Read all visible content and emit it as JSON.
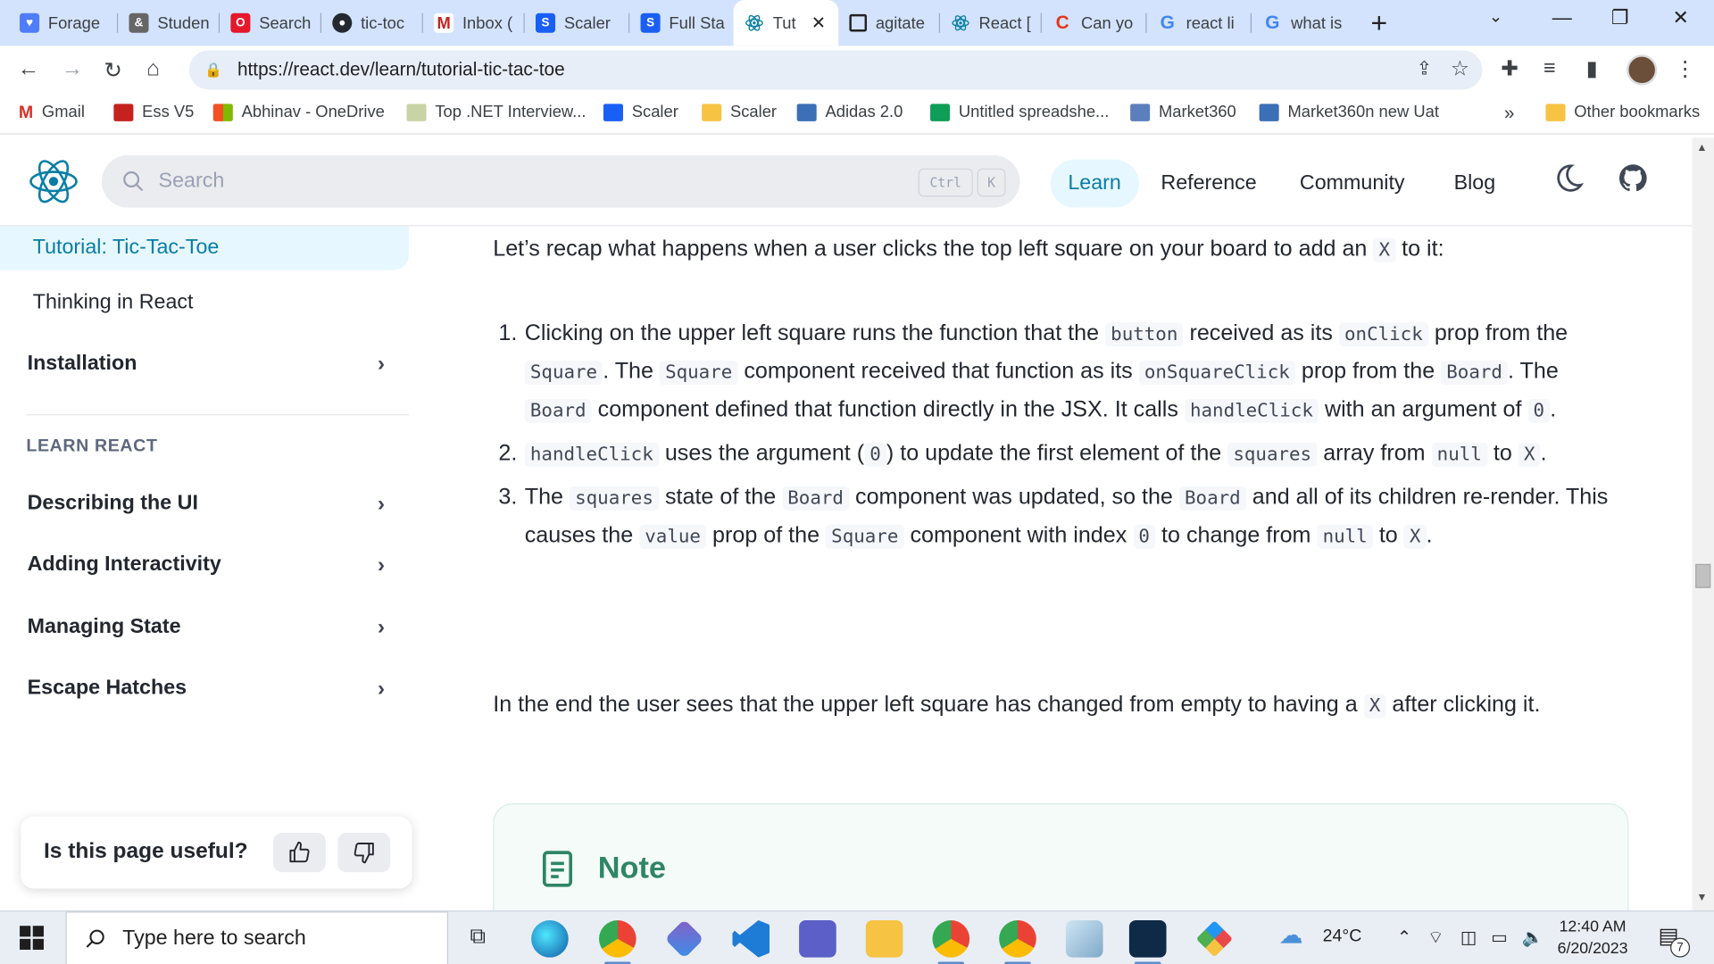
{
  "browser": {
    "tabs": [
      {
        "title": "Forage",
        "icon": "forage-icon",
        "color": "#4f7df9"
      },
      {
        "title": "Studen",
        "icon": "student-icon",
        "color": "#666666"
      },
      {
        "title": "Search",
        "icon": "opera-search-icon",
        "color": "#e5172a"
      },
      {
        "title": "tic-toc",
        "icon": "github-icon",
        "color": "#24292f"
      },
      {
        "title": "Inbox (",
        "icon": "gmail-icon",
        "color": "#c5221f"
      },
      {
        "title": "Scaler",
        "icon": "scaler-icon",
        "color": "#1a5ff5"
      },
      {
        "title": "Full Sta",
        "icon": "scaler-icon",
        "color": "#1a5ff5"
      },
      {
        "title": "Tut",
        "icon": "react-icon",
        "color": "#087ea4",
        "active": true
      },
      {
        "title": "agitate",
        "icon": "page-icon",
        "color": "#222222"
      },
      {
        "title": "React [",
        "icon": "react-icon",
        "color": "#087ea4"
      },
      {
        "title": "Can yo",
        "icon": "c-icon",
        "color": "#e03a1a"
      },
      {
        "title": "react li",
        "icon": "google-icon",
        "color": "#4285f4"
      },
      {
        "title": "what is",
        "icon": "google-icon",
        "color": "#4285f4"
      }
    ],
    "tab_close": "✕",
    "new_tab": "+",
    "url": "https://react.dev/learn/tutorial-tic-tac-toe",
    "bookmarks": [
      {
        "label": "Gmail",
        "color": "#d93025"
      },
      {
        "label": "Ess V5",
        "color": "#c5221f"
      },
      {
        "label": "Abhinav - OneDrive",
        "color": "#f25022"
      },
      {
        "label": "Top .NET Interview...",
        "color": "#8a9a5b"
      },
      {
        "label": "Scaler",
        "color": "#1a5ff5"
      },
      {
        "label": "Scaler",
        "color": "#f6c343"
      },
      {
        "label": "Adidas 2.0",
        "color": "#3b6fb6"
      },
      {
        "label": "Untitled spreadshe...",
        "color": "#0f9d58"
      },
      {
        "label": "Market360",
        "color": "#5b7fbd"
      },
      {
        "label": "Market360n new Uat",
        "color": "#3b6fb6"
      }
    ],
    "more_bookmarks": "»",
    "other_bookmarks": "Other bookmarks"
  },
  "site": {
    "search_placeholder": "Search",
    "kbd_ctrl": "Ctrl",
    "kbd_k": "K",
    "nav": [
      "Learn",
      "Reference",
      "Community",
      "Blog"
    ],
    "accent": "#087ea4"
  },
  "sidebar": {
    "active_item": "Tutorial: Tic-Tac-Toe",
    "thinking": "Thinking in React",
    "installation": "Installation",
    "section_title": "LEARN REACT",
    "items": [
      "Describing the UI",
      "Adding Interactivity",
      "Managing State",
      "Escape Hatches"
    ],
    "feedback_question": "Is this page useful?"
  },
  "content": {
    "intro_a": "Let’s recap what happens when a user clicks the top left square on your board to add an ",
    "intro_code": "X",
    "intro_b": " to it:",
    "steps": [
      {
        "num": "1.",
        "t1": "Clicking on the upper left square runs the function that the ",
        "c1": "button",
        "t2": " received as its ",
        "c2": "onClick",
        "t3": " prop from the ",
        "c3": "Square",
        "t4": ". The ",
        "c4": "Square",
        "t5": " component received that function as its ",
        "c5": "onSquareClick",
        "t6": " prop from the ",
        "c6": "Board",
        "t7": ". The ",
        "c7": "Board",
        "t8": " component defined that function directly in the JSX. It calls ",
        "c8": "handleClick",
        "t9": " with an argument of ",
        "c9": "0",
        "t10": "."
      },
      {
        "num": "2.",
        "c1": "handleClick",
        "t1": " uses the argument (",
        "c2": "0",
        "t2": ") to update the first element of the ",
        "c3": "squares",
        "t3": " array from ",
        "c4": "null",
        "t4": " to ",
        "c5": "X",
        "t5": "."
      },
      {
        "num": "3.",
        "t1": "The ",
        "c1": "squares",
        "t2": " state of the ",
        "c2": "Board",
        "t3": " component was updated, so the ",
        "c3": "Board",
        "t4": " and all of its children re-render. This causes the ",
        "c4": "value",
        "t5": " prop of the ",
        "c5": "Square",
        "t6": " component with index ",
        "c6": "0",
        "t7": " to change from ",
        "c7": "null",
        "t8": " to ",
        "c8": "X",
        "t9": "."
      }
    ],
    "outro_a": "In the end the user sees that the upper left square has changed from empty to having a ",
    "outro_code": "X",
    "outro_b": " after clicking it.",
    "note_title": "Note"
  },
  "taskbar": {
    "search_placeholder": "Type here to search",
    "weather": "24°C",
    "time": "12:40 AM",
    "date": "6/20/2023",
    "notifications": "7"
  }
}
